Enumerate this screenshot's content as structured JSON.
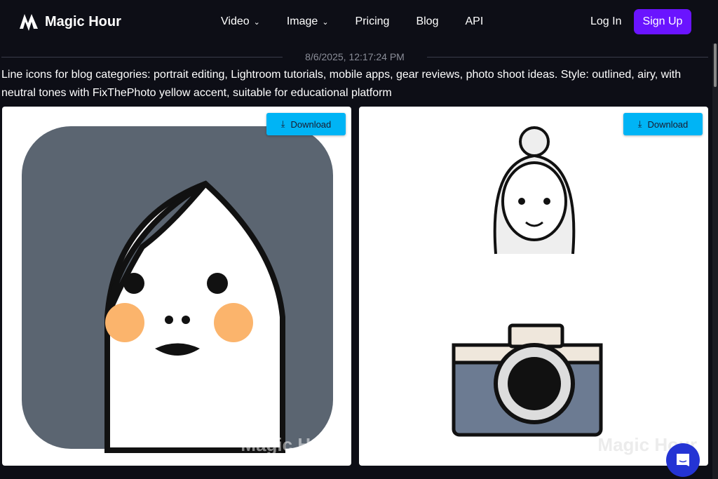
{
  "brand": {
    "name": "Magic Hour"
  },
  "nav": {
    "items": [
      {
        "label": "Video",
        "dropdown": true
      },
      {
        "label": "Image",
        "dropdown": true
      },
      {
        "label": "Pricing"
      },
      {
        "label": "Blog"
      },
      {
        "label": "API"
      }
    ],
    "login": "Log In",
    "signup": "Sign Up"
  },
  "entry": {
    "timestamp": "8/6/2025, 12:17:24 PM",
    "prompt": "Line icons for blog categories: portrait editing, Lightroom tutorials, mobile apps, gear reviews, photo shoot ideas. Style: outlined, airy, with neutral tones with FixThePhoto yellow accent, suitable for educational platform"
  },
  "images": [
    {
      "download": "Download",
      "watermark": "Magic Hour"
    },
    {
      "download": "Download",
      "watermark": "Magic Hour"
    }
  ],
  "colors": {
    "accent": "#6a14ff",
    "download": "#00b4f5",
    "chat": "#2434d4"
  }
}
